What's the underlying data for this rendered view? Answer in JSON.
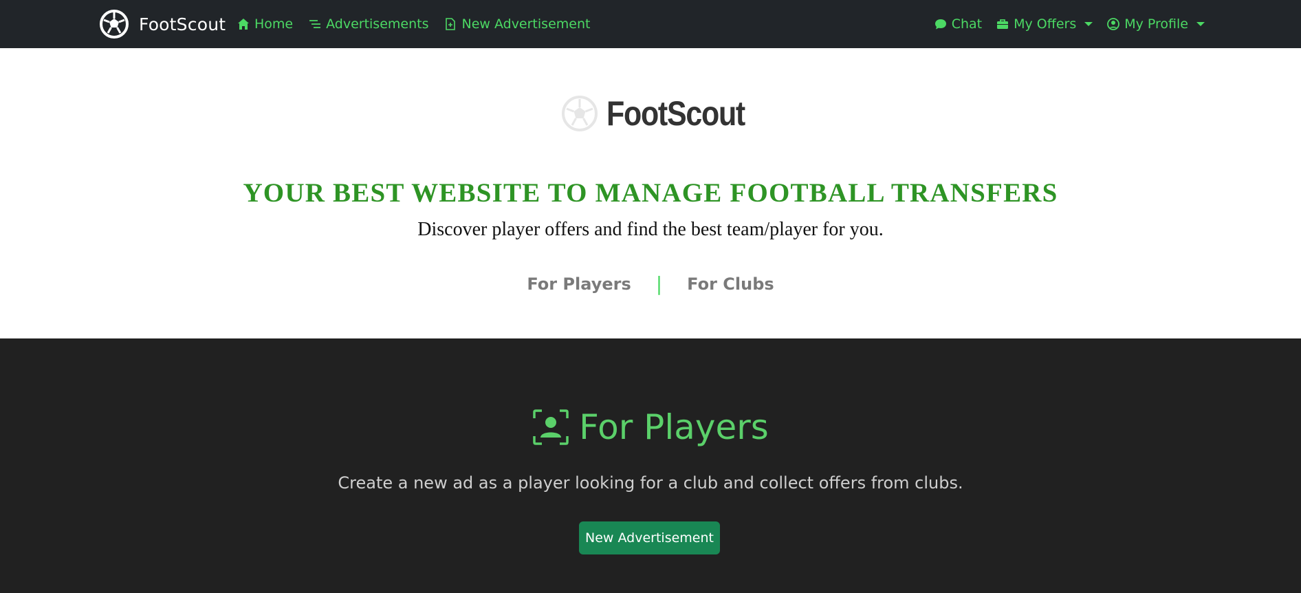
{
  "navbar": {
    "brand": "FootScout",
    "left_links": [
      {
        "label": "Home",
        "icon": "house-icon"
      },
      {
        "label": "Advertisements",
        "icon": "list-icon"
      },
      {
        "label": "New Advertisement",
        "icon": "file-plus-icon"
      }
    ],
    "right_links": [
      {
        "label": "Chat",
        "icon": "chat-bubble-icon"
      },
      {
        "label": "My Offers",
        "icon": "briefcase-icon",
        "dropdown": true
      },
      {
        "label": "My Profile",
        "icon": "user-circle-icon",
        "dropdown": true
      }
    ]
  },
  "hero": {
    "logo_text": "FootScout",
    "headline": "YOUR BEST WEBSITE TO MANAGE FOOTBALL TRANSFERS",
    "subtitle": "Discover player offers and find the best team/player for you.",
    "links": [
      "For Players",
      "For Clubs"
    ],
    "separator": "|"
  },
  "players_section": {
    "title": "For Players",
    "description": "Create a new ad as a player looking for a club and collect offers from clubs.",
    "button_label": "New Advertisement"
  },
  "colors": {
    "navbar_bg": "#212529",
    "accent_green": "#4cd964",
    "headline_green": "#2e9425",
    "section_bg": "#212121",
    "button_green": "#198754"
  }
}
